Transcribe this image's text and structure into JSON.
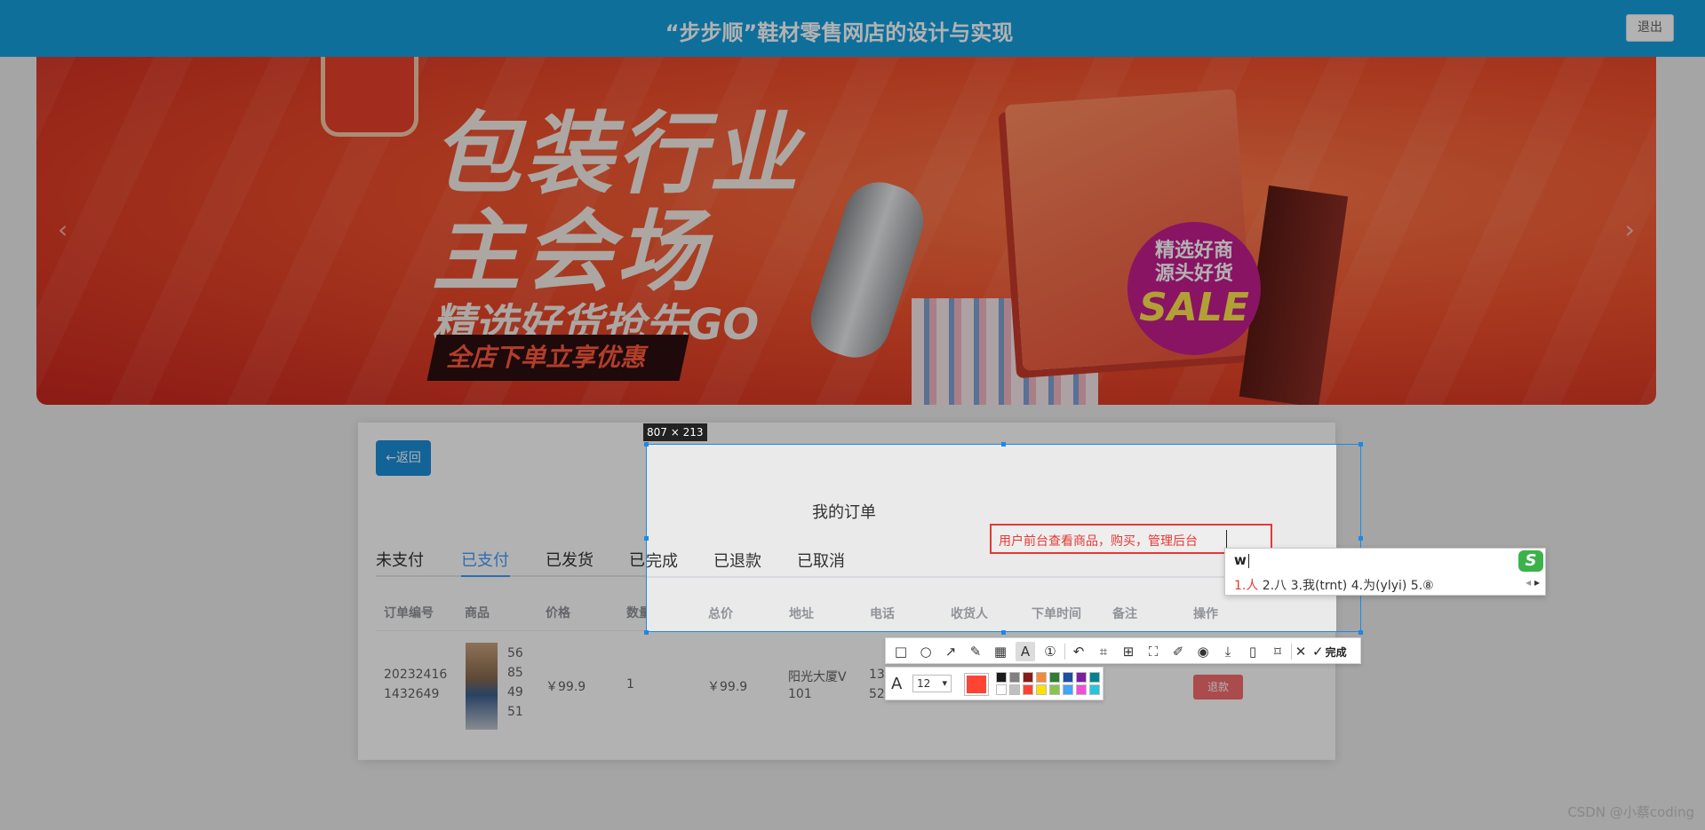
{
  "header": {
    "title": "“步步顺”鞋材零售网店的设计与实现",
    "logout_label": "退出"
  },
  "banner": {
    "headline_line1": "包装行业",
    "headline_line2": "主会场",
    "subline": "精选好货抢先GO",
    "cta": "全店下单立享优惠",
    "badge_line1": "精选好商",
    "badge_line2": "源头好货",
    "badge_sale": "SALE",
    "prev_arrow": "‹",
    "next_arrow": "›"
  },
  "orders": {
    "back_label": "←返回",
    "page_title": "我的订单",
    "tabs": [
      "未支付",
      "已支付",
      "已发货",
      "已完成",
      "已退款",
      "已取消"
    ],
    "active_tab": "已支付",
    "columns": [
      "订单编号",
      "商品",
      "价格",
      "数量",
      "总价",
      "地址",
      "电话",
      "收货人",
      "下单时间",
      "备注",
      "操作"
    ],
    "row": {
      "order_no_1": "20232416",
      "order_no_2": "1432649",
      "product_lines": [
        "56",
        "85",
        "49",
        "51"
      ],
      "price": "￥99.9",
      "qty": "1",
      "total": "￥99.9",
      "address_1": "阳光大厦V",
      "address_2": "101",
      "phone_1": "13",
      "phone_2": "52",
      "action": "退款"
    }
  },
  "capture": {
    "size_label": "807 × 213",
    "text_annotation": "用户前台查看商品，购买，管理后台",
    "font_size": "12",
    "done_label": "完成",
    "current_color": "#ff4433",
    "palette": [
      "#1a1a1a",
      "#808080",
      "#8b1a1a",
      "#f28a3c",
      "#2e7d32",
      "#1e4fa0",
      "#7b1fa2",
      "#00838f",
      "#ffffff",
      "#c0c0c0",
      "#ff4433",
      "#ffe000",
      "#8bc34a",
      "#42a5f5",
      "#f050d8",
      "#26c6da"
    ],
    "tools": [
      "rectangle-icon",
      "ellipse-icon",
      "arrow-icon",
      "pen-icon",
      "mosaic-icon",
      "text-icon",
      "serial-number-icon",
      "undo-icon",
      "ocr-icon",
      "pin-icon",
      "translate-icon",
      "scroll-capture-icon",
      "record-icon",
      "save-icon",
      "phone-icon",
      "bookmark-icon",
      "close-icon",
      "done-check-icon"
    ]
  },
  "ime": {
    "composition": "w",
    "candidates": "1.人  2.八  3.我(trnt)  4.为(ylyi)  5.⑧",
    "first_candidate": "1.人",
    "rest_candidates": "  2.八  3.我(trnt)  4.为(ylyi)  5.⑧",
    "logo": "S"
  },
  "watermark": "CSDN @小蔡coding"
}
